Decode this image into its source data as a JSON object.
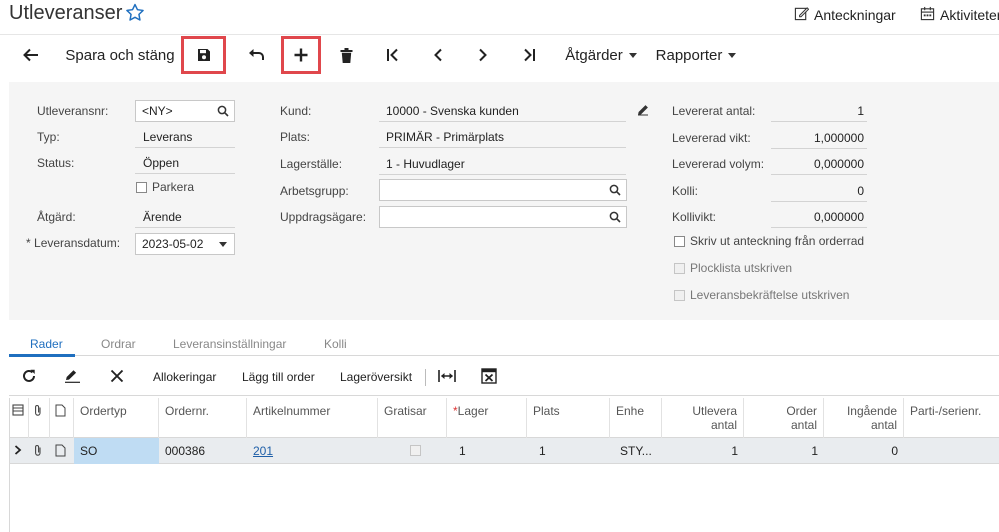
{
  "header": {
    "title": "Utleveranser",
    "notes_label": "Anteckningar",
    "activities_label": "Aktiviteter"
  },
  "toolbar": {
    "save_close_label": "Spara och stäng",
    "actions_label": "Åtgärder",
    "reports_label": "Rapporter"
  },
  "form": {
    "shipment_nbr_label": "Utleveransnr:",
    "shipment_nbr_value": "<NY>",
    "type_label": "Typ:",
    "type_value": "Leverans",
    "status_label": "Status:",
    "status_value": "Öppen",
    "hold_label": "Parkera",
    "action_label": "Åtgärd:",
    "action_value": "Ärende",
    "date_label": "Leveransdatum:",
    "date_value": "2023-05-02",
    "customer_label": "Kund:",
    "customer_value": "10000 - Svenska kunden",
    "location_label": "Plats:",
    "location_value": "PRIMÄR - Primärplats",
    "warehouse_label": "Lagerställe:",
    "warehouse_value": "1 - Huvudlager",
    "workgroup_label": "Arbetsgrupp:",
    "workgroup_value": "",
    "owner_label": "Uppdragsägare:",
    "owner_value": "",
    "shipped_qty_label": "Levererat antal:",
    "shipped_qty_value": "1",
    "shipped_weight_label": "Levererad vikt:",
    "shipped_weight_value": "1,000000",
    "shipped_volume_label": "Levererad volym:",
    "shipped_volume_value": "0,000000",
    "packages_label": "Kolli:",
    "packages_value": "0",
    "package_weight_label": "Kollivikt:",
    "package_weight_value": "0,000000",
    "print_note_label": "Skriv ut anteckning från orderrad",
    "picklist_label": "Plocklista utskriven",
    "confirmation_label": "Leveransbekräftelse utskriven"
  },
  "tabs": [
    "Rader",
    "Ordrar",
    "Leveransinställningar",
    "Kolli"
  ],
  "grid_toolbar": {
    "allocations_label": "Allokeringar",
    "add_order_label": "Lägg till order",
    "inventory_summary_label": "Lageröversikt"
  },
  "grid": {
    "columns": {
      "order_type": "Ordertyp",
      "order_nbr": "Ordernr.",
      "item": "Artikelnummer",
      "free": "Gratisar",
      "warehouse": "Lager",
      "location": "Plats",
      "uom": "Enhe",
      "shipped_qty_1": "Utlevera",
      "shipped_qty_2": "antal",
      "order_qty_1": "Order",
      "order_qty_2": "antal",
      "open_qty_1": "Ingående",
      "open_qty_2": "antal",
      "lot_serial": "Parti-/serienr."
    },
    "rows": [
      {
        "order_type": "SO",
        "order_nbr": "000386",
        "item": "201",
        "warehouse": "1",
        "location": "1",
        "uom": "STY...",
        "shipped_qty": "1",
        "order_qty": "1",
        "open_qty": "0"
      }
    ]
  },
  "colors": {
    "accent": "#1f6fbf",
    "highlight_box": "#e0474c",
    "selected_cell": "#bfdcf3",
    "form_bg": "#f5f5f5"
  }
}
